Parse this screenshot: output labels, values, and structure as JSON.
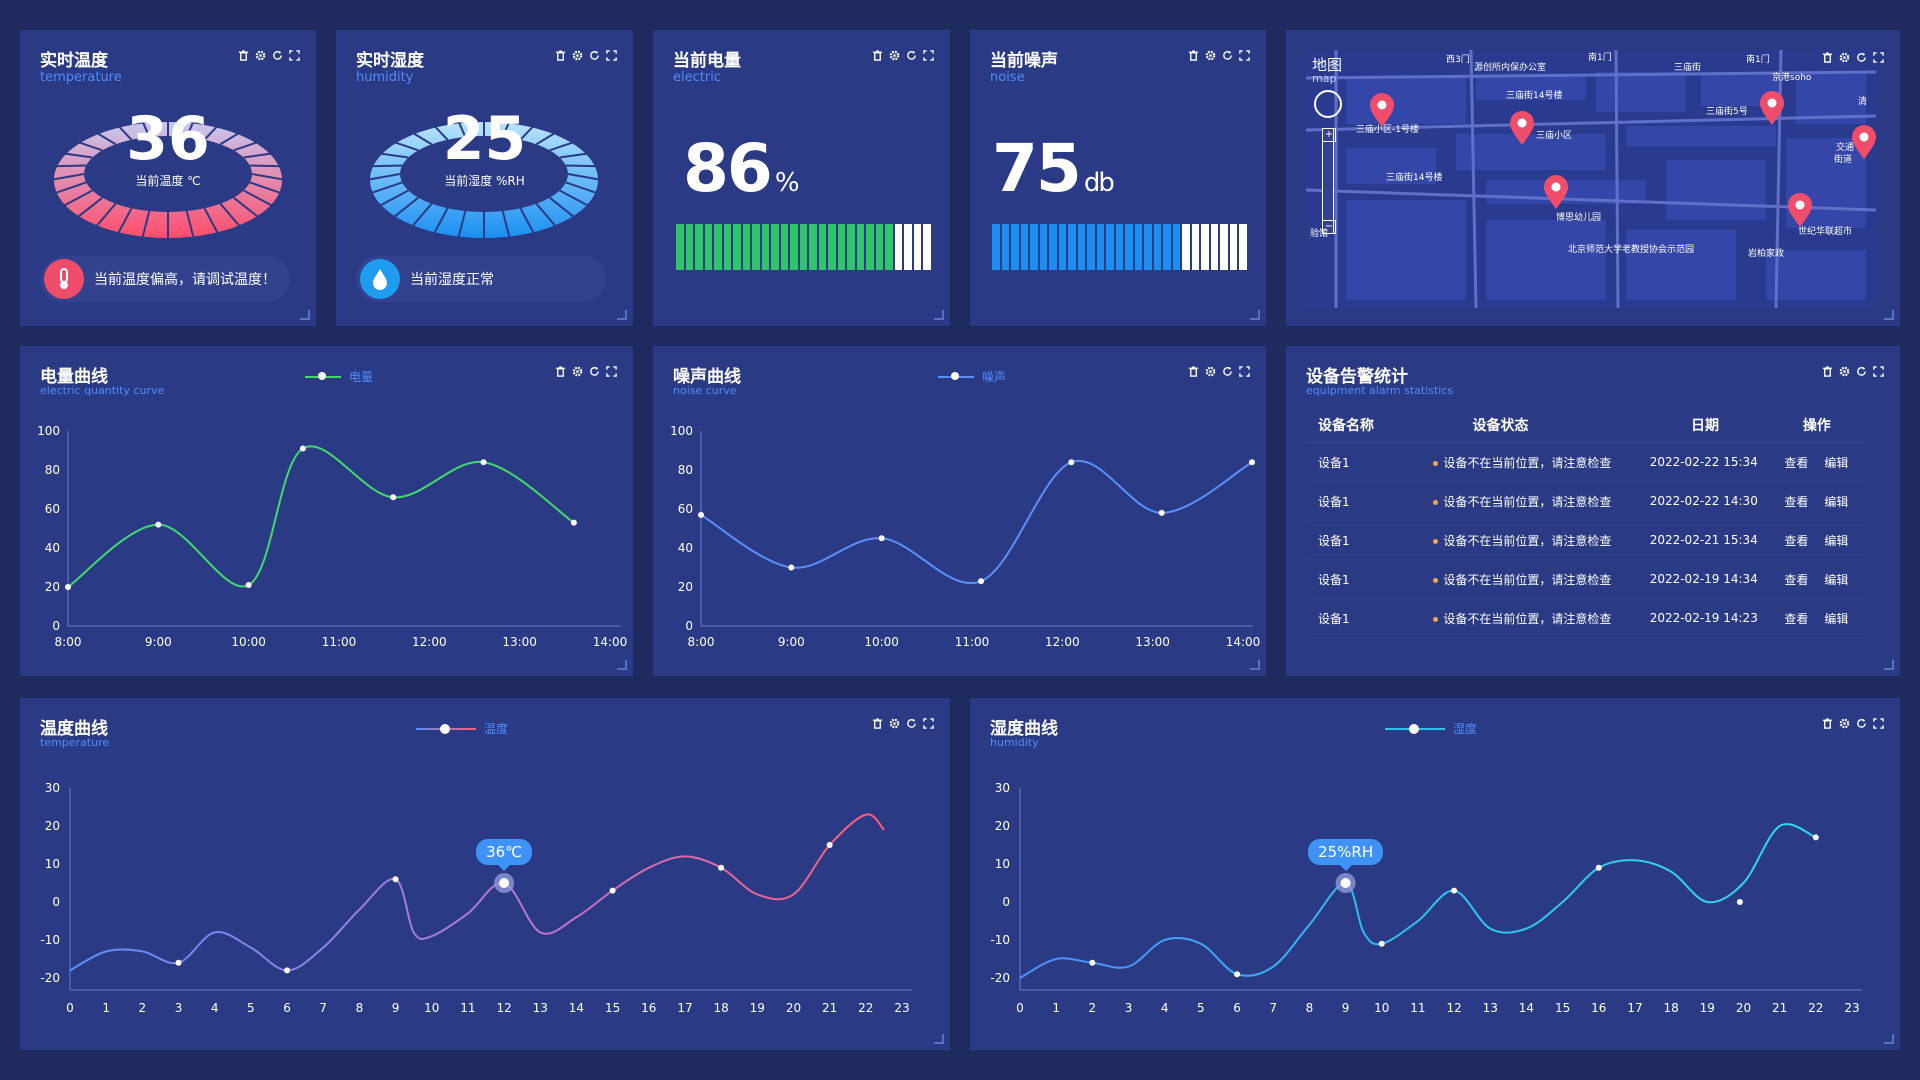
{
  "temperature": {
    "title": "实时温度",
    "subtitle": "temperature",
    "value": "36",
    "label": "当前温度 ℃",
    "alert": "当前温度偏高，请调试温度！"
  },
  "humidity": {
    "title": "实时湿度",
    "subtitle": "humidity",
    "value": "25",
    "label": "当前湿度 %RH",
    "alert": "当前湿度正常"
  },
  "power": {
    "title": "当前电量",
    "subtitle": "electric",
    "value": "86",
    "unit": "%",
    "fraction": 0.86,
    "color": "#2fc56a"
  },
  "noise": {
    "title": "当前噪声",
    "subtitle": "noise",
    "value": "75",
    "unit": "db",
    "fraction": 0.75,
    "color": "#1a8ff0"
  },
  "map": {
    "title": "地图",
    "subtitle": "map",
    "labels": [
      "南1门",
      "西3门",
      "源创所内保办公室",
      "三庙街",
      "南1门",
      "京港soho",
      "三庙街14号楼",
      "三庙小区-1号楼",
      "三庙小区",
      "三庙街5号",
      "清",
      "交通",
      "街道",
      "三庙街14号楼",
      "博思幼儿园",
      "世纪华联超市",
      "北京师范大学老教授协会示范园",
      "岩柏家政",
      "验馆"
    ]
  },
  "toolbar": {
    "icons": [
      "trash-icon",
      "gear-icon",
      "refresh-icon",
      "fullscreen-icon"
    ]
  },
  "power_curve": {
    "title": "电量曲线",
    "subtitle": "electric quantity curve",
    "legend": "电量",
    "chart_data": {
      "type": "line",
      "x": [
        "8:00",
        "9:00",
        "10:00",
        "11:00",
        "12:00",
        "13:00",
        "14:00"
      ],
      "series": [
        {
          "name": "电量",
          "x": [
            8,
            9,
            10,
            10.6,
            11.6,
            12.6,
            13.6
          ],
          "values": [
            20,
            52,
            21,
            91,
            66,
            84,
            53
          ]
        }
      ],
      "yticks": [
        0,
        20,
        40,
        60,
        80,
        100
      ],
      "ylim": [
        0,
        100
      ],
      "color": "#42d96c"
    }
  },
  "noise_curve": {
    "title": "噪声曲线",
    "subtitle": "noise curve",
    "legend": "噪声",
    "chart_data": {
      "type": "line",
      "x": [
        "8:00",
        "9:00",
        "10:00",
        "11:00",
        "12:00",
        "13:00",
        "14:00"
      ],
      "series": [
        {
          "name": "噪声",
          "x": [
            8,
            9,
            10,
            11.1,
            12.1,
            13.1,
            14.1
          ],
          "values": [
            57,
            30,
            45,
            23,
            84,
            58,
            84
          ]
        }
      ],
      "yticks": [
        0,
        20,
        40,
        60,
        80,
        100
      ],
      "ylim": [
        0,
        100
      ],
      "color": "#5b8ff9"
    }
  },
  "alarms": {
    "title": "设备告警统计",
    "subtitle": "equipment alarm statistics",
    "headers": [
      "设备名称",
      "设备状态",
      "日期",
      "操作"
    ],
    "rows": [
      {
        "name": "设备1",
        "status": "设备不在当前位置，请注意检查",
        "date": "2022-02-22  15:34",
        "view": "查看",
        "edit": "编辑"
      },
      {
        "name": "设备1",
        "status": "设备不在当前位置，请注意检查",
        "date": "2022-02-22  14:30",
        "view": "查看",
        "edit": "编辑"
      },
      {
        "name": "设备1",
        "status": "设备不在当前位置，请注意检查",
        "date": "2022-02-21  15:34",
        "view": "查看",
        "edit": "编辑"
      },
      {
        "name": "设备1",
        "status": "设备不在当前位置，请注意检查",
        "date": "2022-02-19  14:34",
        "view": "查看",
        "edit": "编辑"
      },
      {
        "name": "设备1",
        "status": "设备不在当前位置，请注意检查",
        "date": "2022-02-19  14:23",
        "view": "查看",
        "edit": "编辑"
      }
    ]
  },
  "temp_curve": {
    "title": "温度曲线",
    "subtitle": "temperature",
    "legend": "温度",
    "tooltip": "36℃",
    "chart_data": {
      "type": "line",
      "xticks": [
        0,
        1,
        2,
        3,
        4,
        5,
        6,
        7,
        8,
        9,
        10,
        11,
        12,
        13,
        14,
        15,
        16,
        17,
        18,
        19,
        20,
        21,
        22,
        23
      ],
      "series": [
        {
          "name": "温度",
          "x": [
            0,
            1,
            2,
            3,
            4,
            5,
            6,
            7,
            8,
            9,
            9.5,
            10,
            11,
            12,
            13,
            14,
            15,
            16,
            17,
            18,
            19,
            20,
            21,
            22,
            22.5
          ],
          "values": [
            -18,
            -13,
            -13,
            -16,
            -8,
            -12,
            -18,
            -12,
            -2,
            6,
            -8,
            -9,
            -3,
            5,
            -8,
            -4,
            3,
            9,
            12,
            9,
            2,
            2,
            15,
            23,
            19
          ]
        }
      ],
      "points": [
        {
          "x": 3,
          "y": -16
        },
        {
          "x": 6,
          "y": -18
        },
        {
          "x": 9,
          "y": 6
        },
        {
          "x": 12,
          "y": 5
        },
        {
          "x": 15,
          "y": 3
        },
        {
          "x": 18,
          "y": 9
        },
        {
          "x": 21,
          "y": 15
        }
      ],
      "highlight": {
        "x": 12,
        "y": 5
      },
      "yticks": [
        -20,
        -10,
        0,
        10,
        20,
        30
      ],
      "ylim": [
        -20,
        30
      ],
      "xlim": [
        0,
        23
      ]
    }
  },
  "hum_curve": {
    "title": "湿度曲线",
    "subtitle": "humidity",
    "legend": "湿度",
    "tooltip": "25%RH",
    "chart_data": {
      "type": "line",
      "xticks": [
        0,
        1,
        2,
        3,
        4,
        5,
        6,
        7,
        8,
        9,
        10,
        11,
        12,
        13,
        14,
        15,
        16,
        17,
        18,
        19,
        20,
        21,
        22,
        23
      ],
      "series": [
        {
          "name": "湿度",
          "x": [
            0,
            1,
            2,
            3,
            4,
            5,
            6,
            7,
            8,
            9,
            9.5,
            10,
            11,
            12,
            13,
            14,
            15,
            16,
            17,
            18,
            19,
            20,
            21,
            22
          ],
          "values": [
            -20,
            -15,
            -16,
            -17,
            -10,
            -11,
            -19,
            -17,
            -6,
            5,
            -8,
            -11,
            -5,
            3,
            -7,
            -7,
            0,
            9,
            11,
            8,
            0,
            5,
            20,
            17
          ]
        }
      ],
      "points": [
        {
          "x": 2,
          "y": -16
        },
        {
          "x": 6,
          "y": -19
        },
        {
          "x": 9,
          "y": 5
        },
        {
          "x": 10,
          "y": -11
        },
        {
          "x": 12,
          "y": 3
        },
        {
          "x": 16,
          "y": 9
        },
        {
          "x": 19.9,
          "y": 0
        },
        {
          "x": 22,
          "y": 17
        }
      ],
      "highlight": {
        "x": 9,
        "y": 5
      },
      "yticks": [
        -20,
        -10,
        0,
        10,
        20,
        30
      ],
      "ylim": [
        -20,
        30
      ],
      "xlim": [
        0,
        23
      ]
    }
  }
}
